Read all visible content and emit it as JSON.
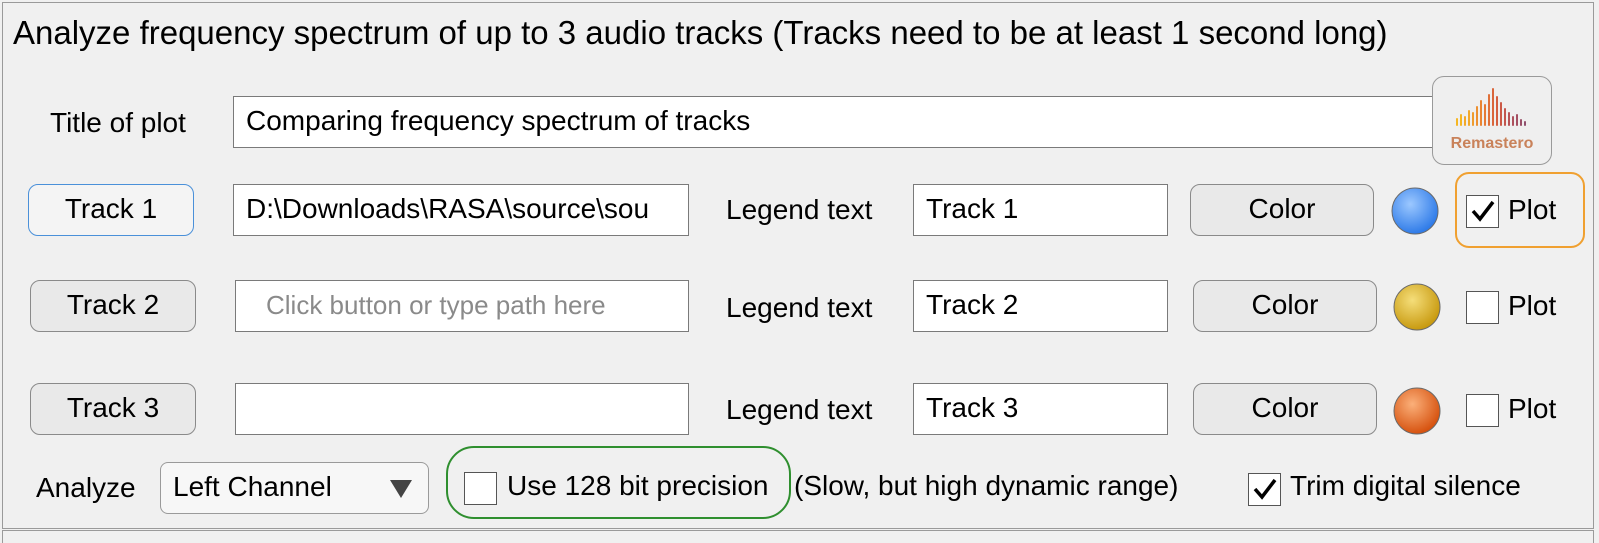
{
  "header": {
    "title": "Analyze frequency spectrum of up to 3 audio tracks (Tracks need to be at least 1 second long)"
  },
  "plot_title": {
    "label": "Title of plot",
    "value": "Comparing frequency spectrum of  tracks"
  },
  "logo": {
    "text": "Remastero",
    "icon": "waveform-logo-icon"
  },
  "tracks": [
    {
      "button_label": "Track 1",
      "path_value": "D:\\Downloads\\RASA\\source\\sou",
      "path_placeholder": "",
      "legend_label": "Legend text",
      "legend_value": "Track 1",
      "color_button": "Color",
      "color": "#3f8ef5",
      "plot_label": "Plot",
      "plot_checked": true
    },
    {
      "button_label": "Track 2",
      "path_value": "",
      "path_placeholder": "Click button or type path here",
      "legend_label": "Legend text",
      "legend_value": "Track 2",
      "color_button": "Color",
      "color": "#e2b21d",
      "plot_label": "Plot",
      "plot_checked": false
    },
    {
      "button_label": "Track 3",
      "path_value": "",
      "path_placeholder": "",
      "legend_label": "Legend text",
      "legend_value": "Track 3",
      "color_button": "Color",
      "color": "#e8651f",
      "plot_label": "Plot",
      "plot_checked": false
    }
  ],
  "options": {
    "analyze_label": "Analyze",
    "channel_selected": "Left Channel",
    "precision_label": "Use 128 bit precision",
    "precision_checked": false,
    "precision_note": "(Slow, but high dynamic range)",
    "trim_label": "Trim digital silence",
    "trim_checked": true
  }
}
